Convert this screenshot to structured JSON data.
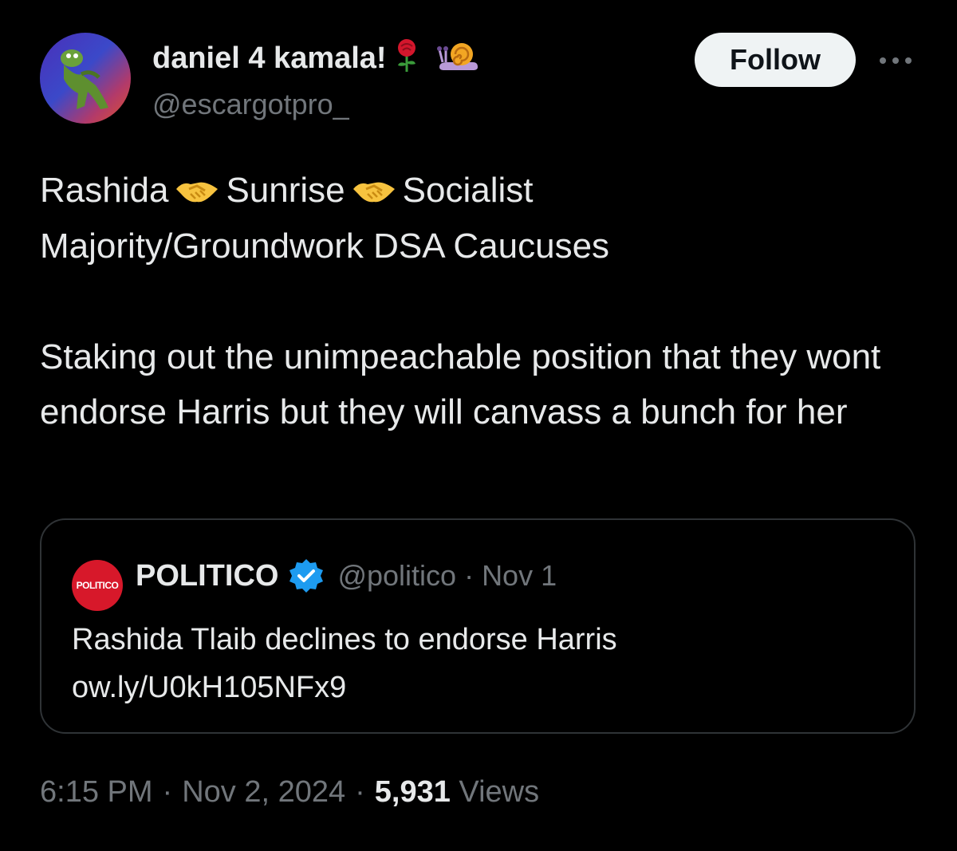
{
  "author": {
    "display_name": "daniel 4 kamala!",
    "emojis": [
      "rose-emoji",
      "snail-emoji"
    ],
    "handle": "@escargotpro_",
    "avatar": "kermit-frog-avatar"
  },
  "actions": {
    "follow_label": "Follow",
    "more_icon": "more-icon"
  },
  "tweet": {
    "line1_part1": "Rashida",
    "line1_part2": "Sunrise",
    "line1_part3": "Socialist",
    "line2": "Majority/Groundwork DSA Caucuses",
    "paragraph2": "Staking out the unimpeachable position that they wont endorse Harris but they will canvass a bunch for her",
    "inline_emoji": "handshake-emoji"
  },
  "quote": {
    "logo_text": "POLITICO",
    "name": "POLITICO",
    "verified_icon": "verified-badge-icon",
    "handle": "@politico",
    "separator": "·",
    "date": "Nov 1",
    "text_line1": "Rashida Tlaib declines to endorse Harris",
    "text_line2": "ow.ly/U0kH105NFx9"
  },
  "meta": {
    "time": "6:15 PM",
    "separator": "·",
    "date": "Nov 2, 2024",
    "views_count": "5,931",
    "views_label": "Views"
  },
  "colors": {
    "background": "#000000",
    "primary_text": "#e7e9ea",
    "secondary_text": "#71767b",
    "border": "#2f3336",
    "follow_bg": "#eff3f4",
    "politico_red": "#d7182a",
    "verified_blue": "#1d9bf0"
  }
}
